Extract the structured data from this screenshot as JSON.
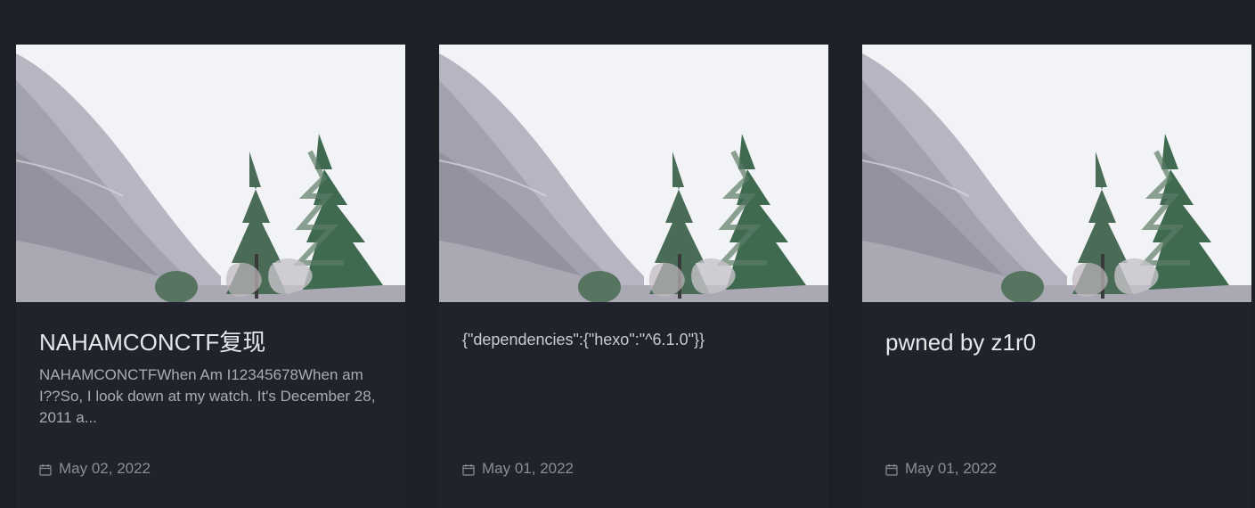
{
  "posts": [
    {
      "title": "NAHAMCONCTF复现",
      "excerpt": "NAHAMCONCTFWhen Am I12345678When am I??So, I look down at my watch. It's December 28, 2011 a...",
      "date": "May 02, 2022",
      "date_icon": "calendar-icon"
    },
    {
      "title": "{\"dependencies\":{\"hexo\":\"^6.1.0\"}}",
      "excerpt": "",
      "date": "May 01, 2022",
      "date_icon": "calendar-icon"
    },
    {
      "title": "pwned by z1r0",
      "excerpt": "",
      "date": "May 01, 2022",
      "date_icon": "calendar-icon"
    }
  ]
}
